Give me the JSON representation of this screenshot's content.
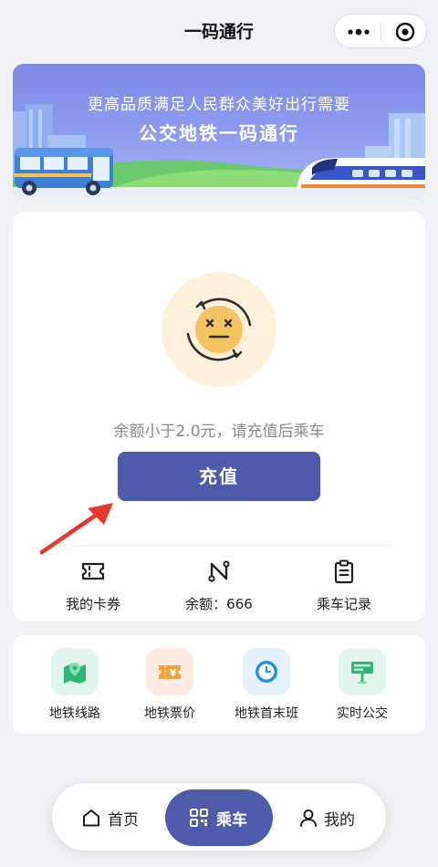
{
  "header": {
    "title": "一码通行",
    "more_icon": "ellipsis-icon",
    "close_icon": "target-close-icon"
  },
  "banner": {
    "line1": "更高品质满足人民群众美好出行需要",
    "line2": "公交地铁一码通行"
  },
  "balance_card": {
    "status_icon": "dizzy-face-refresh-icon",
    "status_text": "余额小于2.0元，请充值后乘车",
    "recharge_label": "充值",
    "quick_links": [
      {
        "icon": "ticket-icon",
        "label": "我的卡券"
      },
      {
        "icon": "balance-n-icon",
        "label": "余额：666"
      },
      {
        "icon": "clipboard-icon",
        "label": "乘车记录"
      }
    ]
  },
  "services": [
    {
      "icon": "metro-map-icon",
      "label": "地铁线路"
    },
    {
      "icon": "fare-ticket-icon",
      "label": "地铁票价"
    },
    {
      "icon": "clock-icon",
      "label": "地铁首末班"
    },
    {
      "icon": "bus-stop-sign-icon",
      "label": "实时公交"
    }
  ],
  "tabbar": {
    "tabs": [
      {
        "icon": "home-icon",
        "label": "首页"
      },
      {
        "icon": "qrcode-icon",
        "label": "乘车"
      },
      {
        "icon": "user-icon",
        "label": "我的"
      }
    ],
    "active": "乘车"
  },
  "colors": {
    "accent": "#4e5bab",
    "background": "#f1f2f5",
    "annotation_arrow": "#e8382d"
  }
}
